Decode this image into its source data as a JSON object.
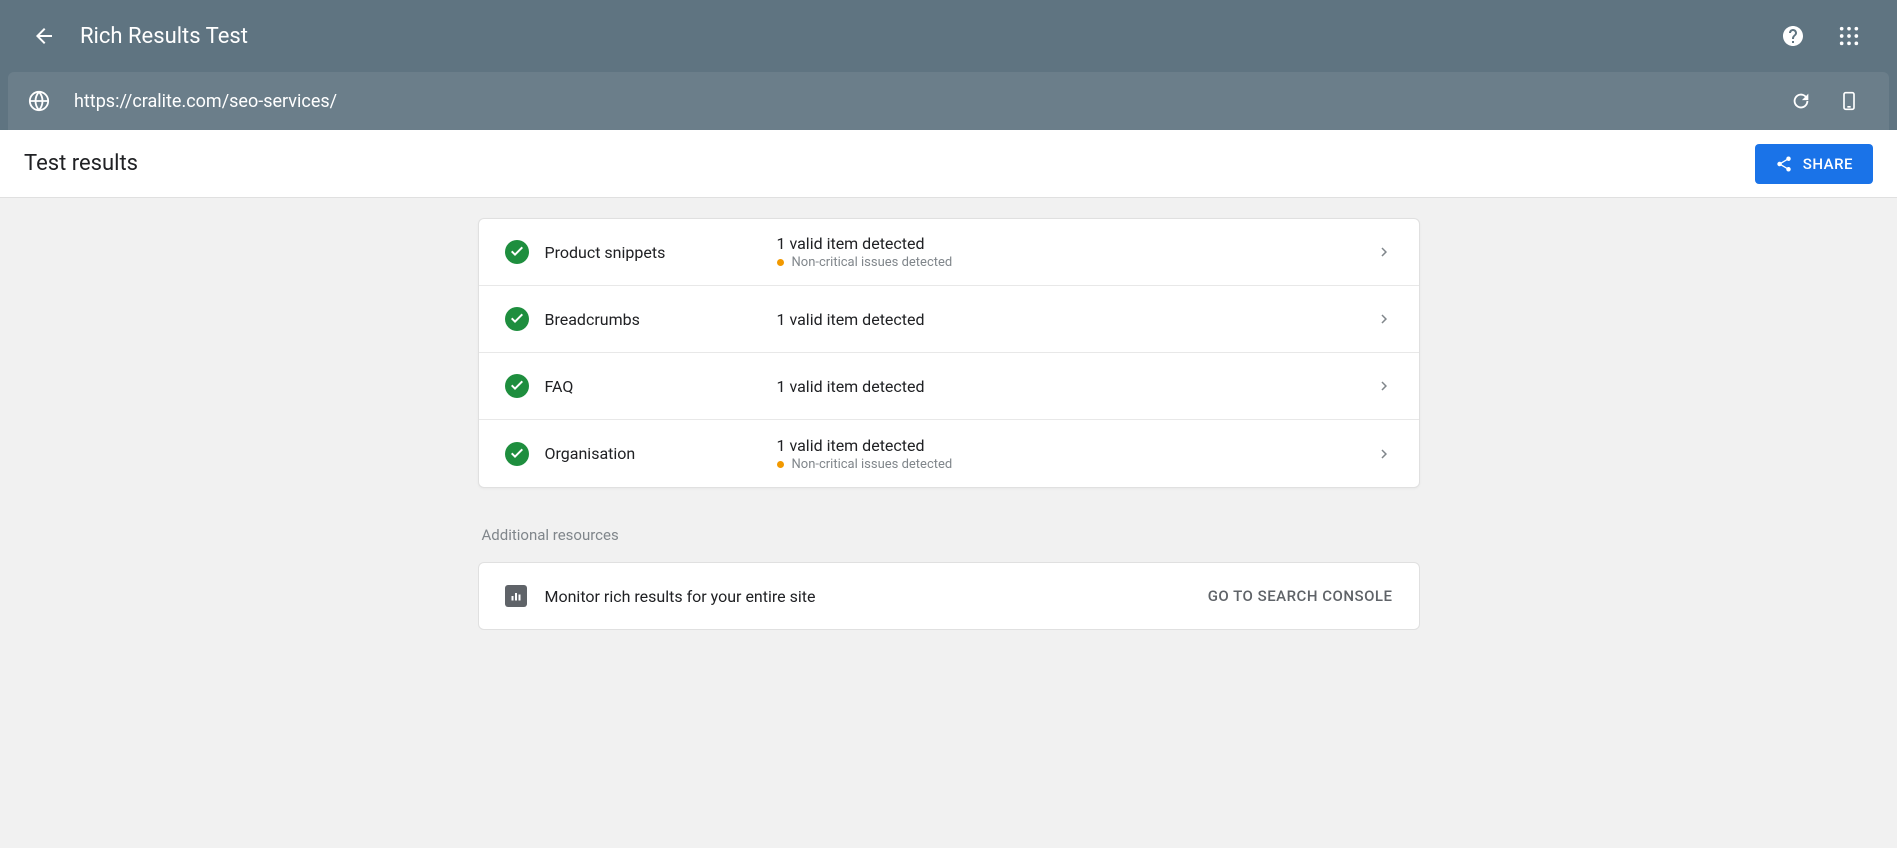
{
  "header": {
    "title": "Rich Results Test"
  },
  "urlbar": {
    "url": "https://cralite.com/seo-services/"
  },
  "results_bar": {
    "label": "Test results",
    "share_label": "SHARE"
  },
  "items": [
    {
      "name": "Product snippets",
      "primary": "1 valid item detected",
      "secondary": "Non-critical issues detected",
      "has_warning": true
    },
    {
      "name": "Breadcrumbs",
      "primary": "1 valid item detected",
      "secondary": "",
      "has_warning": false
    },
    {
      "name": "FAQ",
      "primary": "1 valid item detected",
      "secondary": "",
      "has_warning": false
    },
    {
      "name": "Organisation",
      "primary": "1 valid item detected",
      "secondary": "Non-critical issues detected",
      "has_warning": true
    }
  ],
  "additional": {
    "title": "Additional resources",
    "monitor_text": "Monitor rich results for your entire site",
    "console_action": "GO TO SEARCH CONSOLE"
  }
}
